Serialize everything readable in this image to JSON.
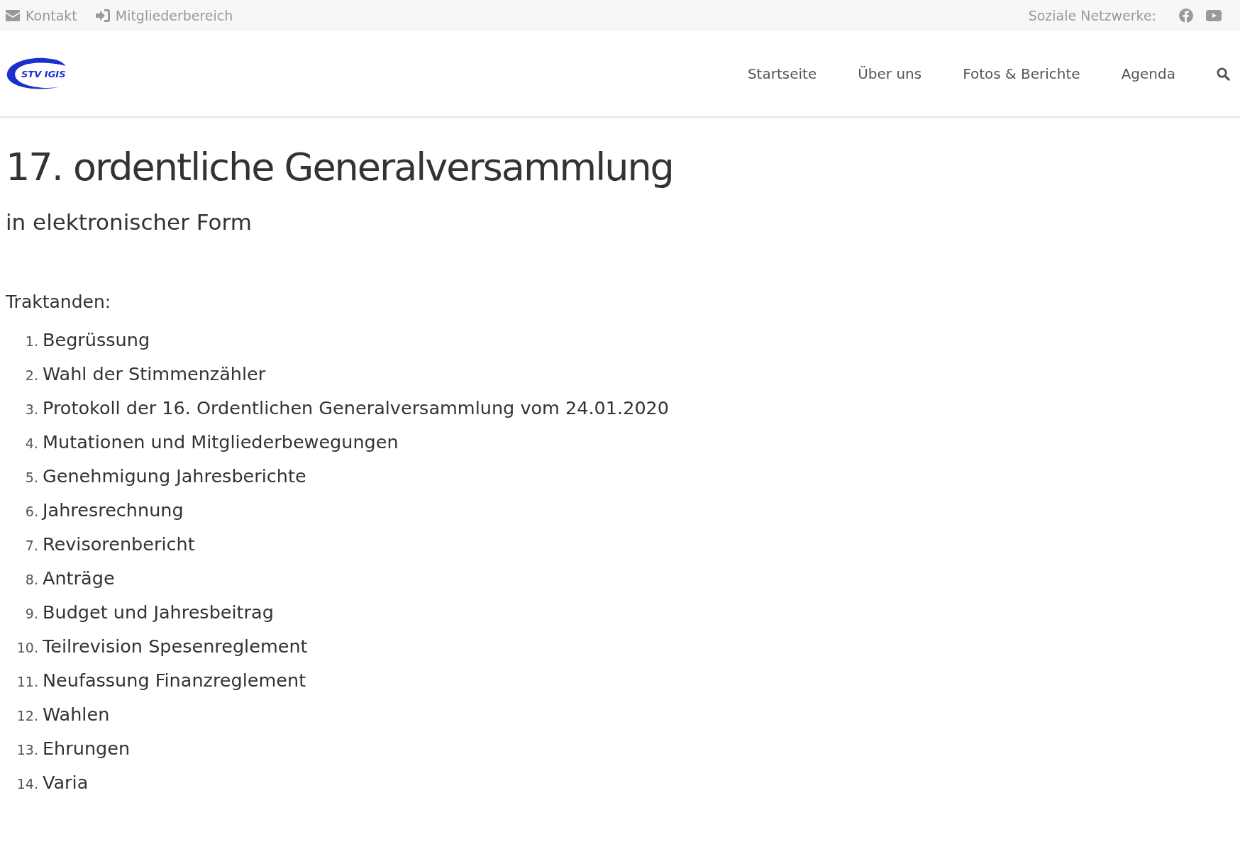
{
  "top_bar": {
    "links": [
      {
        "kind": "mail",
        "label": "Kontakt"
      },
      {
        "kind": "login",
        "label": "Mitgliederbereich"
      }
    ],
    "social_label": "Soziale Netzwerke:",
    "social": [
      {
        "kind": "facebook"
      },
      {
        "kind": "youtube"
      }
    ]
  },
  "header": {
    "logo_text": "STV IGIS",
    "nav": [
      {
        "label": "Startseite"
      },
      {
        "label": "Über uns"
      },
      {
        "label": "Fotos & Berichte"
      },
      {
        "label": "Agenda"
      }
    ]
  },
  "page": {
    "title": "17. ordentliche Generalversammlung",
    "subtitle": "in elektronischer Form",
    "intro": "Traktanden:",
    "items": [
      {
        "number": "1.",
        "text": "Begrüssung"
      },
      {
        "number": "2.",
        "text": "Wahl der Stimmenzähler"
      },
      {
        "number": "3.",
        "text": "Protokoll der 16. Ordentlichen Generalversammlung vom 24.01.2020"
      },
      {
        "number": "4.",
        "text": "Mutationen und Mitgliederbewegungen"
      },
      {
        "number": "5.",
        "text": "Genehmigung Jahresberichte"
      },
      {
        "number": "6.",
        "text": "Jahresrechnung"
      },
      {
        "number": "7.",
        "text": "Revisorenbericht"
      },
      {
        "number": "8.",
        "text": "Anträge"
      },
      {
        "number": "9.",
        "text": "Budget und Jahresbeitrag"
      },
      {
        "number": "10.",
        "text": "Teilrevision Spesenreglement"
      },
      {
        "number": "11.",
        "text": "Neufassung Finanzreglement"
      },
      {
        "number": "12.",
        "text": "Wahlen"
      },
      {
        "number": "13.",
        "text": "Ehrungen"
      },
      {
        "number": "14.",
        "text": "Varia"
      }
    ]
  }
}
